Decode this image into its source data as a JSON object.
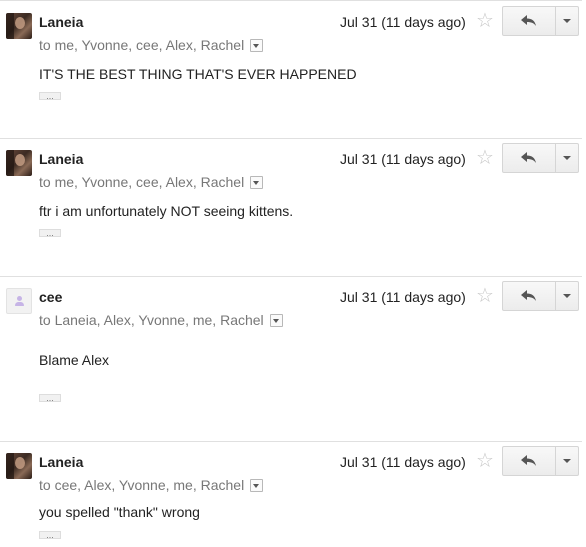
{
  "messages": [
    {
      "sender": "Laneia",
      "recipients": "to me, Yvonne, cee, Alex, Rachel",
      "date": "Jul 31 (11 days ago)",
      "body": "IT'S THE BEST THING THAT'S EVER HAPPENED",
      "avatar": "photo",
      "ellipsis": "..."
    },
    {
      "sender": "Laneia",
      "recipients": "to me, Yvonne, cee, Alex, Rachel",
      "date": "Jul 31 (11 days ago)",
      "body": "ftr i am unfortunately NOT seeing kittens.",
      "avatar": "photo",
      "ellipsis": "..."
    },
    {
      "sender": "cee",
      "recipients": "to Laneia, Alex, Yvonne, me, Rachel",
      "date": "Jul 31 (11 days ago)",
      "body": "Blame Alex",
      "avatar": "default-person",
      "ellipsis": "..."
    },
    {
      "sender": "Laneia",
      "recipients": "to cee, Alex, Yvonne, me, Rachel",
      "date": "Jul 31 (11 days ago)",
      "body": "you spelled \"thank\" wrong",
      "avatar": "photo",
      "ellipsis": "..."
    }
  ],
  "icons": {
    "star": "star-outline-icon",
    "reply": "reply-arrow-icon",
    "more": "chevron-down-icon",
    "details": "show-details-icon"
  },
  "colors": {
    "muted_text": "#777777",
    "star": "#c8c8c8",
    "divider": "#e0e0e0"
  }
}
